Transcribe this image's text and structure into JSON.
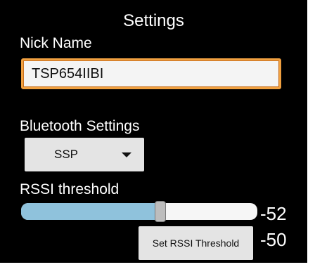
{
  "screen": {
    "title": "Settings"
  },
  "nick_name": {
    "label": "Nick Name",
    "value": "TSP654IIBI"
  },
  "bluetooth": {
    "label": "Bluetooth Settings",
    "selected": "SSP",
    "caret_icon": "caret-down-icon"
  },
  "rssi": {
    "label": "RSSI threshold",
    "slider_value": "-52",
    "slider_fraction": 0.59,
    "button_label": "Set RSSI Threshold",
    "threshold_value": "-50"
  },
  "colors": {
    "background": "#000000",
    "text": "#ffffff",
    "input_focus_border": "#f0a040",
    "slider_fill": "#8fc2dc",
    "button_bg": "#e4e4e4"
  }
}
